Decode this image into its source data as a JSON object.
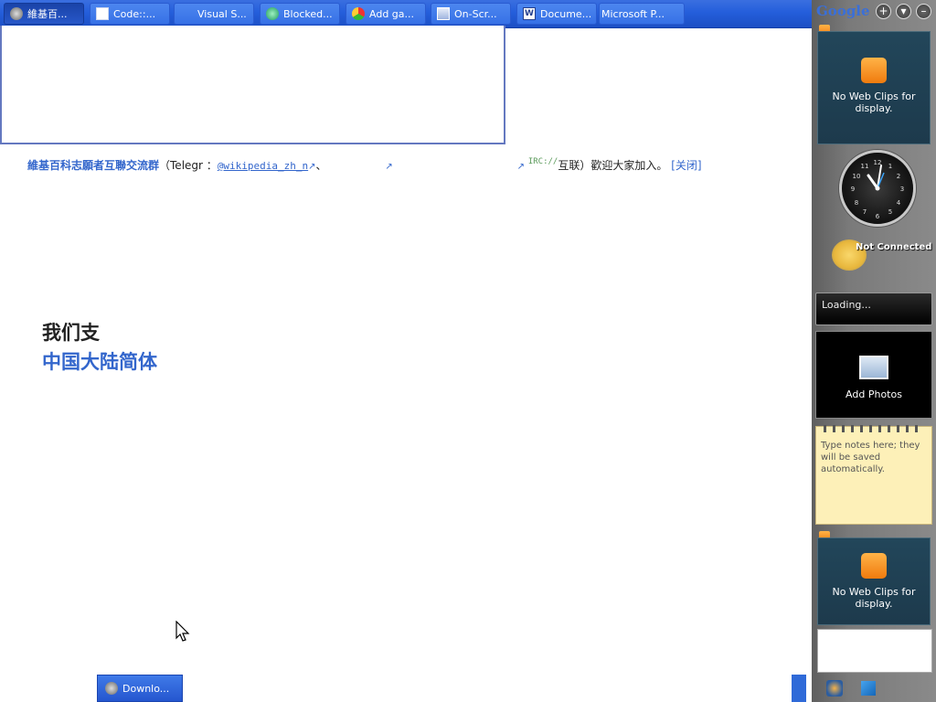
{
  "taskbar": {
    "tasks": [
      {
        "label": "維基百...",
        "icon": "wiki-icon",
        "active": true
      },
      {
        "label": "Code::...",
        "icon": "window-icon"
      },
      {
        "label": "Visual S...",
        "icon": "blank-icon"
      },
      {
        "label": "Blocked...",
        "icon": "chat-icon"
      },
      {
        "label": "Add ga...",
        "icon": "chrome-icon"
      },
      {
        "label": "On-Scr...",
        "icon": "keyboard-icon"
      },
      {
        "label": "Docume...",
        "icon": "word-icon"
      },
      {
        "label": "Microsoft P...",
        "icon": "blank-icon"
      }
    ]
  },
  "page": {
    "notice": {
      "bold_text": "維基百科志願者互聯交流群",
      "paren_text": "（Telegr",
      "colon": "：",
      "link": "@wikipedia_zh_n",
      "link_suffix": "、",
      "irc_label": "IRC://",
      "tail": "互联）歡迎大家加入。",
      "close": "[关闭]"
    },
    "heading_line1": "我们支",
    "heading_line2": "中国大陆简体"
  },
  "sidebar": {
    "google_logo": "Google",
    "buttons": [
      "+",
      "▾",
      "–"
    ],
    "webclip_top": "No Web Clips for display.",
    "weather_status": "Not Connected",
    "loading_text": "Loading...",
    "photos_label": "Add Photos",
    "notes_text": "Type notes here; they will be saved automatically.",
    "webclip_bottom": "No Web Clips for display."
  },
  "bottom_taskbar": {
    "download_label": "Downlo..."
  },
  "colors": {
    "taskbar_blue": "#245edb",
    "link_blue": "#3366cc",
    "note_yellow": "#fdf0b8"
  }
}
